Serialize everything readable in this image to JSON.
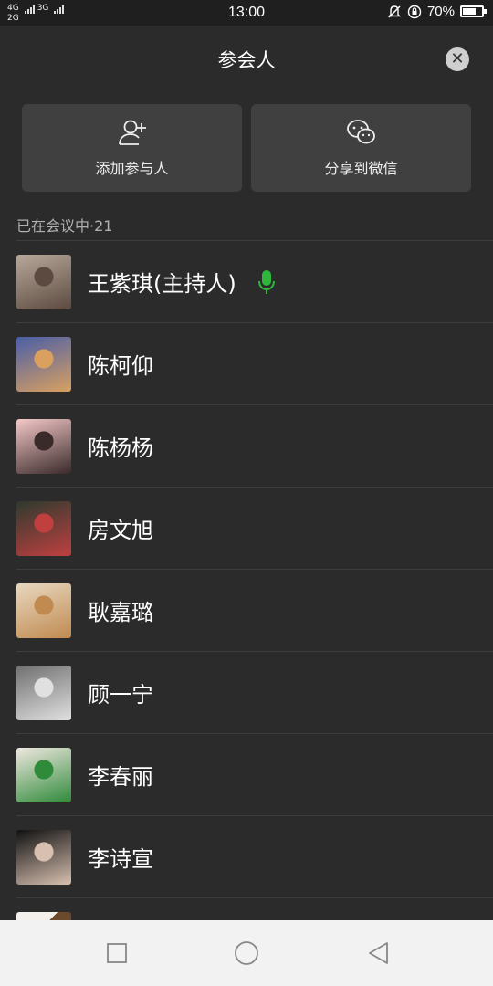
{
  "status_bar": {
    "network_top": "4G",
    "network_bottom": "2G",
    "network_third": "3G",
    "time": "13:00",
    "battery_percent": "70%",
    "battery_level": 0.7
  },
  "header": {
    "title": "参会人",
    "close_icon": "close-icon"
  },
  "actions": [
    {
      "label": "添加参与人",
      "icon": "add-person-icon"
    },
    {
      "label": "分享到微信",
      "icon": "wechat-icon"
    }
  ],
  "section": {
    "label": "已在会议中·21"
  },
  "participants": [
    {
      "name": "王紫琪(主持人)",
      "mic_on": true,
      "avatar_colors": [
        "#b8a89a",
        "#5c4a40"
      ]
    },
    {
      "name": "陈柯仰",
      "avatar_colors": [
        "#4a5ea8",
        "#d9a060"
      ]
    },
    {
      "name": "陈杨杨",
      "avatar_colors": [
        "#f4c8c8",
        "#3a2a2a"
      ]
    },
    {
      "name": "房文旭",
      "avatar_colors": [
        "#2e3a2e",
        "#c04040"
      ]
    },
    {
      "name": "耿嘉璐",
      "avatar_colors": [
        "#e8d8c0",
        "#c08a50"
      ]
    },
    {
      "name": "顾一宁",
      "avatar_colors": [
        "#707070",
        "#e0e0e0"
      ]
    },
    {
      "name": "李春丽",
      "avatar_colors": [
        "#f0e8e0",
        "#2f8a3a"
      ]
    },
    {
      "name": "李诗宣",
      "avatar_colors": [
        "#111111",
        "#d8c0b0"
      ]
    }
  ],
  "accent": {
    "mic_green": "#2db83d"
  },
  "nav": {
    "recent_icon": "square-icon",
    "home_icon": "circle-icon",
    "back_icon": "back-triangle-icon"
  }
}
